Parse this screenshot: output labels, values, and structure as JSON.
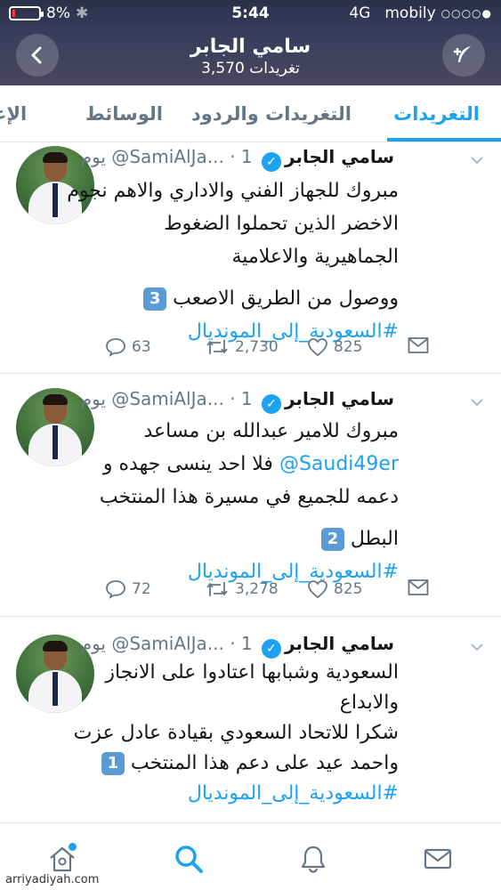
{
  "status_bar": {
    "battery_percent": "8%",
    "time": "5:44",
    "network": "4G",
    "carrier": "mobily",
    "signal_dots": "○○○○●",
    "battery_level": 0.08,
    "battery_color": "#ff3b30"
  },
  "header": {
    "name": "سامي الجابر",
    "tweet_count": "3,570",
    "tweet_count_label": "تغريدات",
    "back_icon": "chevron-left-icon",
    "compose_icon": "feather-plus-icon"
  },
  "tabs": [
    {
      "label": "التغريدات",
      "active": true
    },
    {
      "label": "التغريدات والردود",
      "active": false
    },
    {
      "label": "الوسائط",
      "active": false
    },
    {
      "label": "الإعجا",
      "active": false
    }
  ],
  "accent_color": "#1da1f2",
  "tweets": [
    {
      "name": "سامي الجابر",
      "handle": "@SamiAlJa...",
      "dot": "·",
      "time": "1 يوم",
      "lines": [
        "مبروك للجهاز الفني والاداري والاهم نجوم",
        "الاخضر الذين تحملوا الضغوط",
        "الجماهيرية والاعلامية"
      ],
      "line4_text": "ووصول من الطريق الاصعب",
      "badge": "3",
      "hashtag": "#السعودية_إلى_المونديال",
      "replies": "63",
      "retweets": "2,730",
      "likes": "825"
    },
    {
      "name": "سامي الجابر",
      "handle": "@SamiAlJa...",
      "dot": "·",
      "time": "1 يوم",
      "line1": "مبروك للامير عبدالله بن مساعد",
      "mention": "@Saudi49er",
      "line2_rest": "فلا احد ينسى جهده و",
      "line3": "دعمه للجميع في مسيرة هذا المنتخب",
      "line4_text": "البطل",
      "badge": "2",
      "hashtag": "#السعودية_إلى_المونديال",
      "replies": "72",
      "retweets": "3,278",
      "likes": "825"
    },
    {
      "name": "سامي الجابر",
      "handle": "@SamiAlJa...",
      "dot": "·",
      "time": "1 يوم",
      "lines": [
        "السعودية وشبابها اعتادوا على الانجاز",
        "والابداع",
        "شكرا للاتحاد السعودي بقيادة عادل عزت"
      ],
      "line4_text": "واحمد عيد على دعم هذا المنتخب",
      "badge": "1",
      "hashtag": "#السعودية_إلى_المونديال"
    }
  ],
  "bottom_nav": [
    {
      "icon": "home-icon",
      "has_dot": true
    },
    {
      "icon": "search-icon",
      "active": true
    },
    {
      "icon": "bell-icon"
    },
    {
      "icon": "mail-icon"
    }
  ],
  "watermark": "arriyadiyah.com"
}
